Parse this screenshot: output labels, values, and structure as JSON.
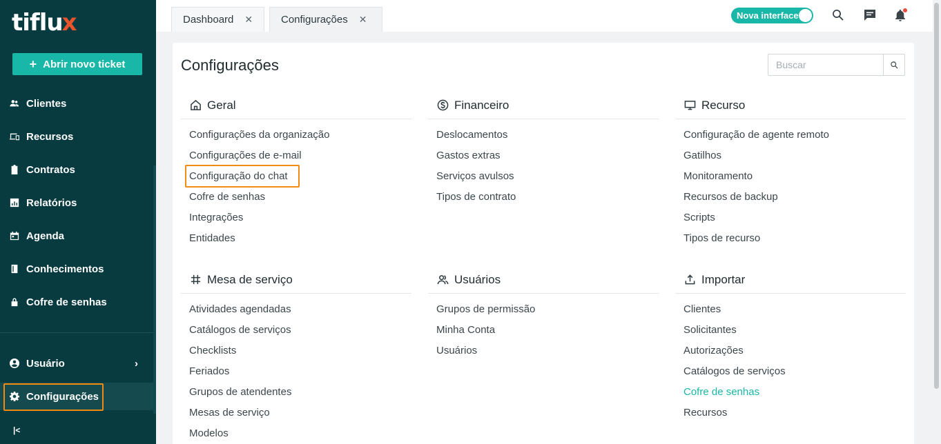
{
  "sidebar": {
    "logo_text": "tiflu",
    "logo_x": "x",
    "new_ticket_label": "Abrir novo ticket",
    "items": [
      {
        "label": "Clientes",
        "icon": "users-icon"
      },
      {
        "label": "Recursos",
        "icon": "devices-icon"
      },
      {
        "label": "Contratos",
        "icon": "clipboard-icon"
      },
      {
        "label": "Relatórios",
        "icon": "chart-icon"
      },
      {
        "label": "Agenda",
        "icon": "calendar-icon"
      },
      {
        "label": "Conhecimentos",
        "icon": "book-icon"
      },
      {
        "label": "Cofre de senhas",
        "icon": "lock-icon"
      }
    ],
    "user_label": "Usuário",
    "settings_label": "Configurações",
    "collapse_label": "|<"
  },
  "tabs": [
    {
      "label": "Dashboard",
      "close": "✕"
    },
    {
      "label": "Configurações",
      "close": "✕"
    }
  ],
  "topbar": {
    "toggle_label": "Nova interface"
  },
  "page": {
    "title": "Configurações",
    "search_placeholder": "Buscar"
  },
  "sections": [
    {
      "title": "Geral",
      "icon": "home-icon",
      "links": [
        "Configurações da organização",
        "Configurações de e-mail",
        "Configuração do chat",
        "Cofre de senhas",
        "Integrações",
        "Entidades"
      ]
    },
    {
      "title": "Financeiro",
      "icon": "dollar-icon",
      "links": [
        "Deslocamentos",
        "Gastos extras",
        "Serviços avulsos",
        "Tipos de contrato"
      ]
    },
    {
      "title": "Recurso",
      "icon": "monitor-icon",
      "links": [
        "Configuração de agente remoto",
        "Gatilhos",
        "Monitoramento",
        "Recursos de backup",
        "Scripts",
        "Tipos de recurso"
      ]
    },
    {
      "title": "Mesa de serviço",
      "icon": "hash-icon",
      "links": [
        "Atividades agendadas",
        "Catálogos de serviços",
        "Checklists",
        "Feriados",
        "Grupos de atendentes",
        "Mesas de serviço",
        "Modelos"
      ]
    },
    {
      "title": "Usuários",
      "icon": "users-outline-icon",
      "links": [
        "Grupos de permissão",
        "Minha Conta",
        "Usuários"
      ]
    },
    {
      "title": "Importar",
      "icon": "upload-icon",
      "links": [
        "Clientes",
        "Solicitantes",
        "Autorizações",
        "Catálogos de serviços",
        "Cofre de senhas",
        "Recursos"
      ]
    }
  ],
  "colors": {
    "sidebar_bg": "#073b40",
    "accent": "#18b7a7",
    "highlight": "#f28b11",
    "logo_accent": "#e8542c"
  }
}
